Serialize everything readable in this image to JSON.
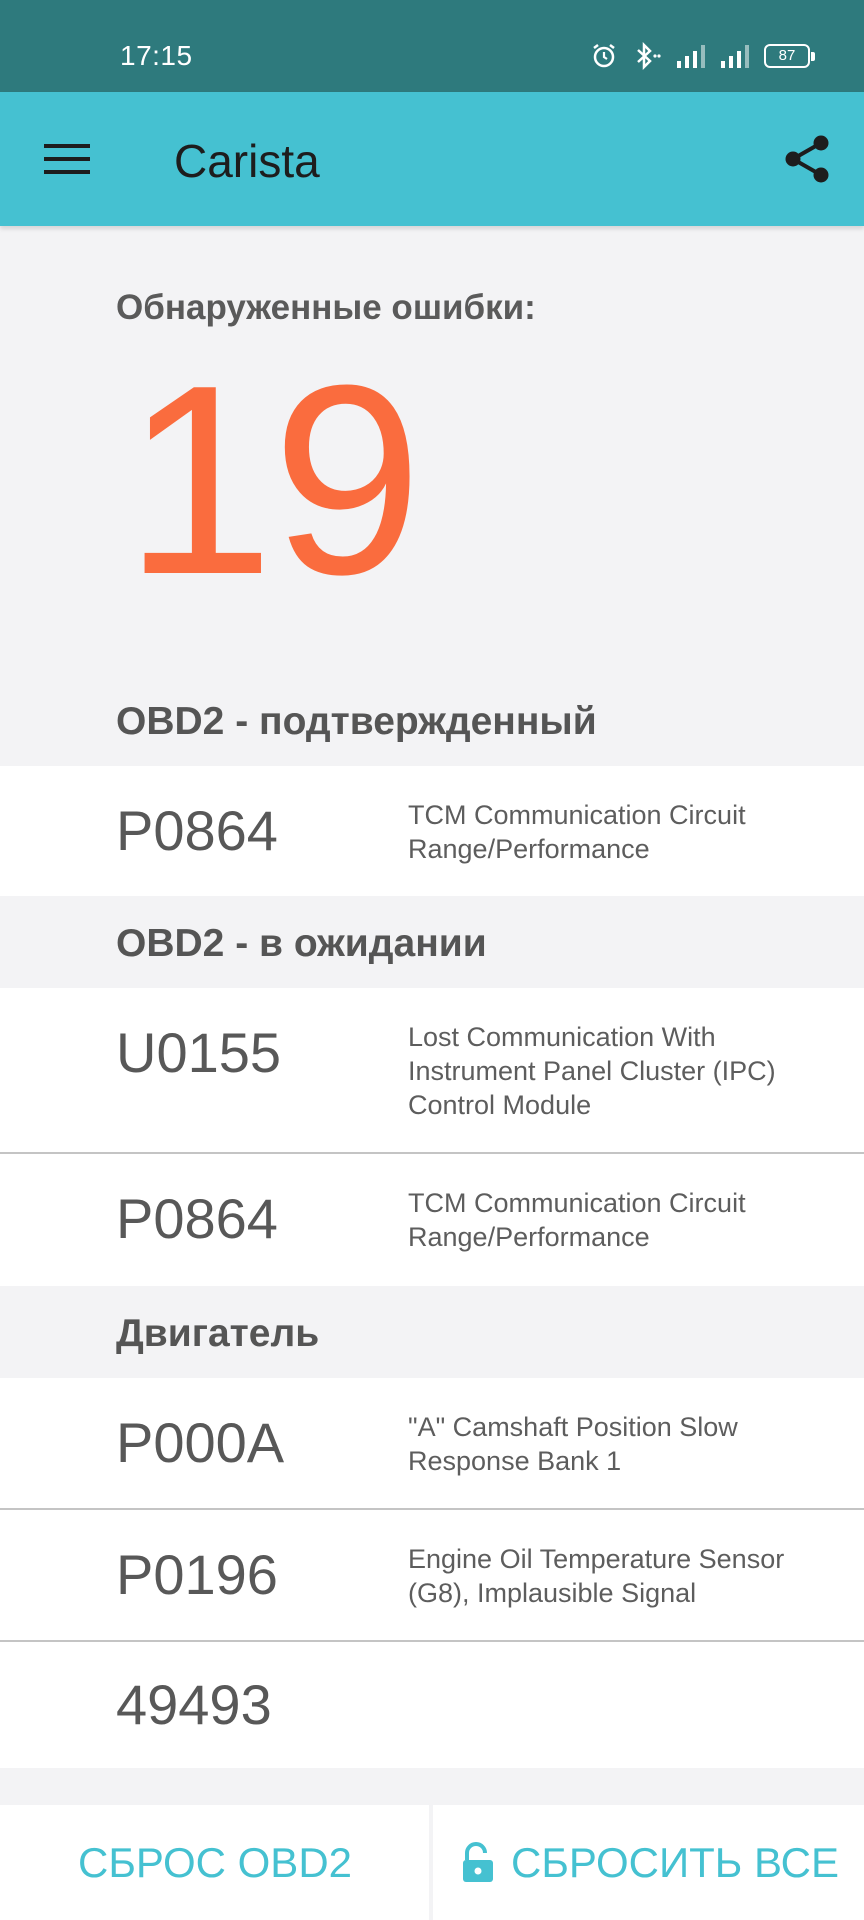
{
  "status": {
    "time": "17:15",
    "battery": "87"
  },
  "app_bar": {
    "title": "Carista"
  },
  "summary": {
    "label": "Обнаруженные ошибки:",
    "count": "19"
  },
  "sections": [
    {
      "title": "OBD2 - подтвержденный",
      "rows": [
        {
          "code": "P0864",
          "description": "TCM Communication Circuit Range/Performance"
        }
      ]
    },
    {
      "title": "OBD2 - в ожидании",
      "rows": [
        {
          "code": "U0155",
          "description": "Lost Communication With Instrument Panel Cluster (IPC) Control Module"
        },
        {
          "code": "P0864",
          "description": "TCM Communication Circuit Range/Performance"
        }
      ]
    },
    {
      "title": "Двигатель",
      "rows": [
        {
          "code": "P000A",
          "description": "\"A\" Camshaft Position Slow Response Bank 1"
        },
        {
          "code": "P0196",
          "description": "Engine Oil Temperature Sensor (G8), Implausible Signal"
        },
        {
          "code": "49493",
          "description": ""
        }
      ]
    }
  ],
  "bottom_bar": {
    "reset_obd2_label": "СБРОС OBD2",
    "reset_all_label": "СБРОСИТЬ ВСЕ"
  },
  "colors": {
    "accent": "#45c1d1",
    "status_bar": "#2e7a7d",
    "count": "#fa6c3e"
  }
}
